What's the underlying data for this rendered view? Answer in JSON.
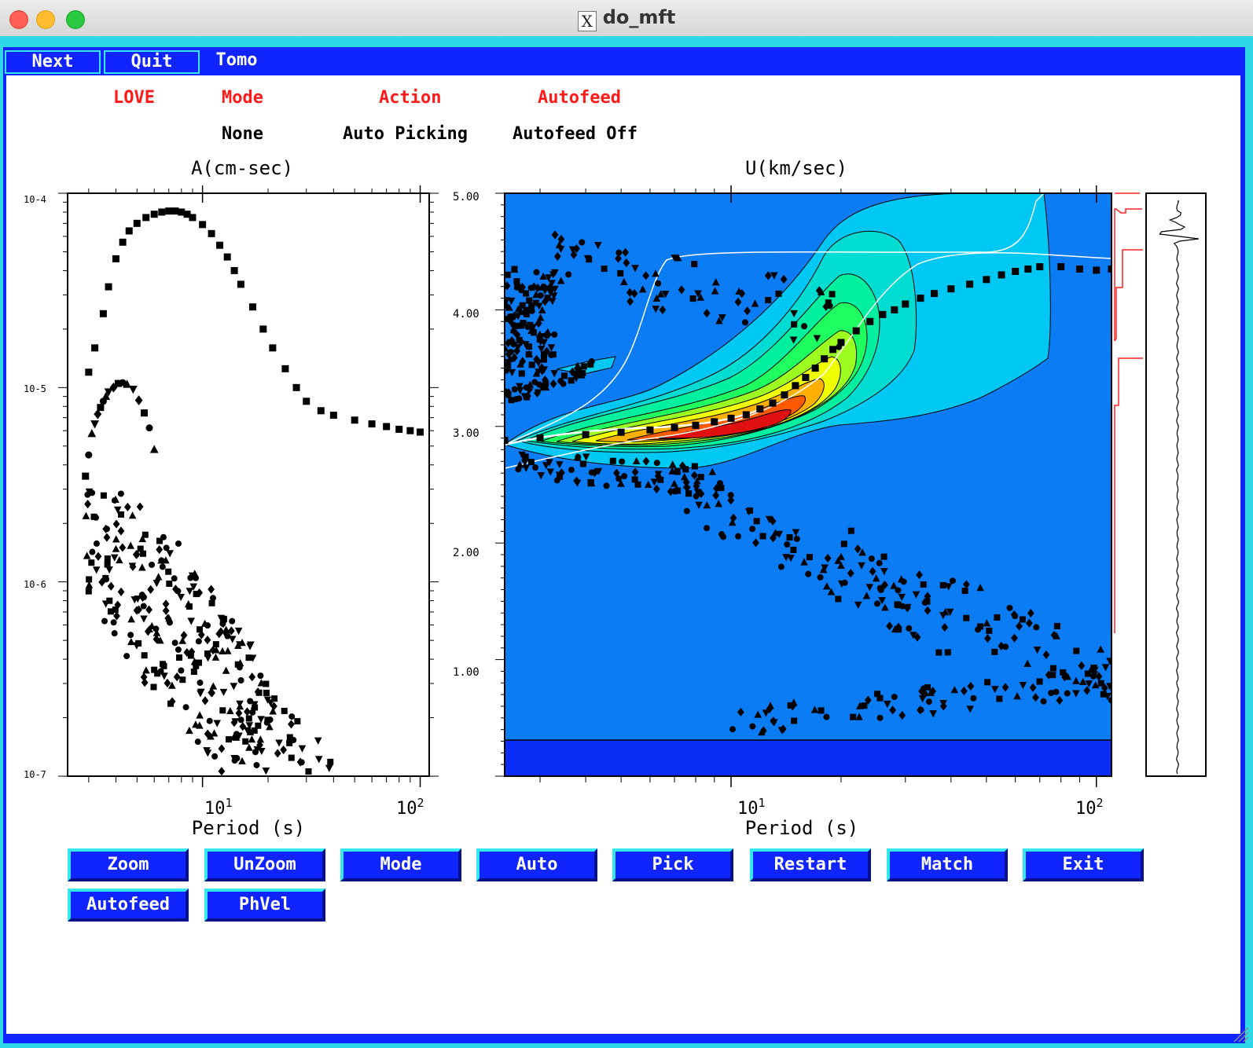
{
  "window": {
    "title": "do_mft"
  },
  "menubar": {
    "next_label": "Next",
    "quit_label": "Quit",
    "tomo_label": "Tomo"
  },
  "status": {
    "type_label": "LOVE",
    "mode_label": "Mode",
    "action_label": "Action",
    "autofeed_label": "Autofeed",
    "mode_value": "None",
    "action_value": "Auto Picking",
    "autofeed_value": "Autofeed Off"
  },
  "plots": {
    "amp_title": "A(cm-sec)",
    "vel_title": "U(km/sec)",
    "xlabel": "Period (s)",
    "amp_ticks": [
      "10-4",
      "10-5",
      "10-6",
      "10-7"
    ],
    "vel_ticks": [
      "5.00",
      "4.00",
      "3.00",
      "2.00",
      "1.00"
    ],
    "x_ticks_base": [
      "10",
      "10"
    ],
    "x_ticks_exp": [
      "1",
      "2"
    ]
  },
  "buttons": [
    "Zoom",
    "UnZoom",
    "Mode",
    "Auto",
    "Pick",
    "Restart",
    "Match",
    "Exit",
    "Autofeed",
    "PhVel"
  ],
  "colors": {
    "menubar": "#1024ff",
    "frame": "#2ed8e6",
    "plot_bg": "#0b7cf4",
    "status_red": "#ff1a1a"
  },
  "chart_data": [
    {
      "type": "scatter",
      "title": "A(cm-sec)",
      "xlabel": "Period (s)",
      "ylabel": "",
      "log_x": true,
      "log_y": true,
      "xlim": [
        2.4,
        110
      ],
      "ylim": [
        1e-07,
        0.0001
      ],
      "series": [
        {
          "x": [
            3,
            3.2,
            3.5,
            3.7,
            4,
            4.3,
            4.6,
            5,
            5.5,
            6,
            6.5,
            7,
            7.5,
            8,
            8.5,
            9,
            10,
            11,
            12,
            13,
            14,
            15,
            17,
            19,
            21,
            24,
            27,
            30,
            35,
            40,
            50,
            60,
            70,
            80,
            90,
            100
          ],
          "y": [
            1.2e-05,
            1.6e-05,
            2.4e-05,
            3.3e-05,
            4.6e-05,
            5.6e-05,
            6.4e-05,
            7e-05,
            7.5e-05,
            7.8e-05,
            8e-05,
            8.1e-05,
            8.1e-05,
            8e-05,
            7.8e-05,
            7.5e-05,
            6.9e-05,
            6.2e-05,
            5.4e-05,
            4.7e-05,
            4e-05,
            3.4e-05,
            2.6e-05,
            2e-05,
            1.6e-05,
            1.25e-05,
            1e-05,
            8.5e-06,
            7.6e-06,
            7.2e-06,
            6.8e-06,
            6.5e-06,
            6.3e-06,
            6.1e-06,
            6e-06,
            5.9e-06
          ]
        },
        {
          "x": [
            2.9,
            3.0,
            3.1,
            3.2,
            3.3,
            3.4,
            3.5,
            3.6,
            3.7,
            3.9,
            4.1,
            4.3,
            4.5,
            4.8,
            5.1,
            5.4,
            5.7,
            6.0
          ],
          "y": [
            3.5e-06,
            4.5e-06,
            5.8e-06,
            6.5e-06,
            7.3e-06,
            7.9e-06,
            8.5e-06,
            9e-06,
            9.5e-06,
            1e-05,
            1.05e-05,
            1.06e-05,
            1.04e-05,
            9.8e-06,
            8.6e-06,
            7.4e-06,
            6.2e-06,
            4.8e-06
          ]
        }
      ]
    },
    {
      "type": "heatmap",
      "title": "U(km/sec)",
      "xlabel": "Period (s)",
      "ylabel": "",
      "log_x": true,
      "xlim": [
        2.4,
        110
      ],
      "ylim": [
        0.0,
        5.0
      ],
      "series": [
        {
          "x": [
            2.4,
            3,
            4,
            5,
            6,
            7,
            8,
            9,
            10,
            11,
            12,
            13,
            14,
            15,
            16,
            17,
            18,
            19,
            20,
            22,
            24,
            26,
            28,
            30,
            33,
            36,
            40,
            45,
            50,
            55,
            60,
            65,
            70,
            80,
            90,
            100,
            110
          ],
          "y": [
            2.88,
            2.9,
            2.93,
            2.95,
            2.97,
            2.99,
            3.01,
            3.04,
            3.07,
            3.1,
            3.15,
            3.2,
            3.27,
            3.35,
            3.42,
            3.5,
            3.58,
            3.66,
            3.72,
            3.82,
            3.9,
            3.96,
            4.0,
            4.05,
            4.1,
            4.14,
            4.18,
            4.22,
            4.26,
            4.3,
            4.33,
            4.35,
            4.37,
            4.37,
            4.35,
            4.34,
            4.35
          ]
        }
      ]
    }
  ]
}
